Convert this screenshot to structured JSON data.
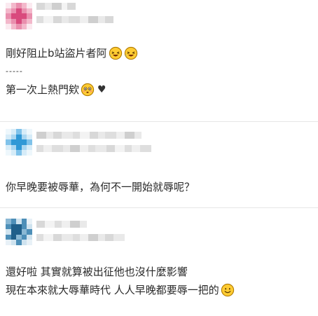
{
  "comments": [
    {
      "avatar": {
        "palette": [
          "#f6d6e2",
          "#e98fae",
          "#d94a7d",
          "#f3b8cb",
          "#fbeaf0"
        ]
      },
      "lines": [
        {
          "text": "剛好阻止b站盜片者阿",
          "emojis": [
            "rofl-emoji",
            "rofl-emoji"
          ]
        },
        {
          "text": "-----"
        },
        {
          "text": "第一次上熱門欸",
          "emojis": [
            "flushed-emoji"
          ],
          "suffix": "♥"
        }
      ]
    },
    {
      "avatar": {
        "palette": [
          "#d6ecf8",
          "#7fc2ea",
          "#2f98d6",
          "#a9d6f1",
          "#eef7fc"
        ]
      },
      "lines": [
        {
          "text": "你早晚要被辱華，為何不一開始就辱呢？"
        }
      ]
    },
    {
      "avatar": {
        "palette": [
          "#cfe3ef",
          "#4d8fb8",
          "#1f5f8a",
          "#8ab8d4",
          "#e8f1f7"
        ]
      },
      "lines": [
        {
          "text": "還好啦 其實就算被出征他也沒什麼影響"
        },
        {
          "text": "現在本來就大辱華時代 人人早晚都要辱一把的",
          "emojis": [
            "smile-emoji"
          ]
        }
      ]
    }
  ],
  "colors": {
    "text": "#2a2a2a",
    "divider": "#e6e6e6",
    "mosaic": "#e4e4e4",
    "emoji_face": "#ffcc33",
    "emoji_outline": "#b07a00"
  }
}
